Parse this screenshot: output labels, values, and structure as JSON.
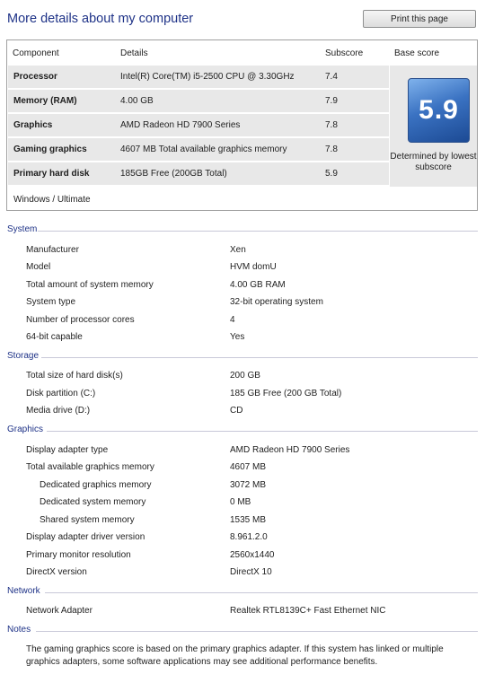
{
  "header": {
    "title": "More details about my computer",
    "print_label": "Print this page"
  },
  "score_table": {
    "columns": [
      "Component",
      "Details",
      "Subscore",
      "Base score"
    ],
    "rows": [
      {
        "component": "Processor",
        "details": "Intel(R) Core(TM) i5-2500 CPU @ 3.30GHz",
        "subscore": "7.4"
      },
      {
        "component": "Memory (RAM)",
        "details": "4.00 GB",
        "subscore": "7.9"
      },
      {
        "component": "Graphics",
        "details": "AMD Radeon HD 7900 Series",
        "subscore": "7.8"
      },
      {
        "component": "Gaming graphics",
        "details": "4607 MB Total available graphics memory",
        "subscore": "7.8"
      },
      {
        "component": "Primary hard disk",
        "details": "185GB Free (200GB Total)",
        "subscore": "5.9"
      }
    ],
    "base_score": "5.9",
    "base_note": "Determined by lowest subscore",
    "edition": "Windows / Ultimate"
  },
  "sections": {
    "system": {
      "title": "System",
      "items": [
        {
          "label": "Manufacturer",
          "value": "Xen"
        },
        {
          "label": "Model",
          "value": "HVM domU"
        },
        {
          "label": "Total amount of system memory",
          "value": "4.00 GB RAM"
        },
        {
          "label": "System type",
          "value": "32-bit operating system"
        },
        {
          "label": "Number of processor cores",
          "value": "4"
        },
        {
          "label": "64-bit capable",
          "value": "Yes"
        }
      ]
    },
    "storage": {
      "title": "Storage",
      "items": [
        {
          "label": "Total size of hard disk(s)",
          "value": "200 GB"
        },
        {
          "label": "Disk partition (C:)",
          "value": "185 GB Free (200 GB Total)"
        },
        {
          "label": "Media drive (D:)",
          "value": "CD"
        }
      ]
    },
    "graphics": {
      "title": "Graphics",
      "items": [
        {
          "label": "Display adapter type",
          "value": "AMD Radeon HD 7900 Series"
        },
        {
          "label": "Total available graphics memory",
          "value": "4607 MB"
        },
        {
          "label": "Dedicated graphics memory",
          "value": "3072 MB"
        },
        {
          "label": "Dedicated system memory",
          "value": "0 MB"
        },
        {
          "label": "Shared system memory",
          "value": "1535 MB"
        },
        {
          "label": "Display adapter driver version",
          "value": "8.961.2.0"
        },
        {
          "label": "Primary monitor resolution",
          "value": "2560x1440"
        },
        {
          "label": "DirectX version",
          "value": "DirectX 10"
        }
      ]
    },
    "network": {
      "title": "Network",
      "items": [
        {
          "label": "Network Adapter",
          "value": "Realtek RTL8139C+ Fast Ethernet NIC"
        }
      ]
    },
    "notes": {
      "title": "Notes",
      "text": "The gaming graphics score is based on the primary graphics adapter. If this system has linked or multiple graphics adapters, some software applications may see additional performance benefits."
    }
  },
  "colors": {
    "title_blue": "#1e3287",
    "row_shade": "#e8e8e8",
    "badge_blue": "#3a72c2"
  }
}
